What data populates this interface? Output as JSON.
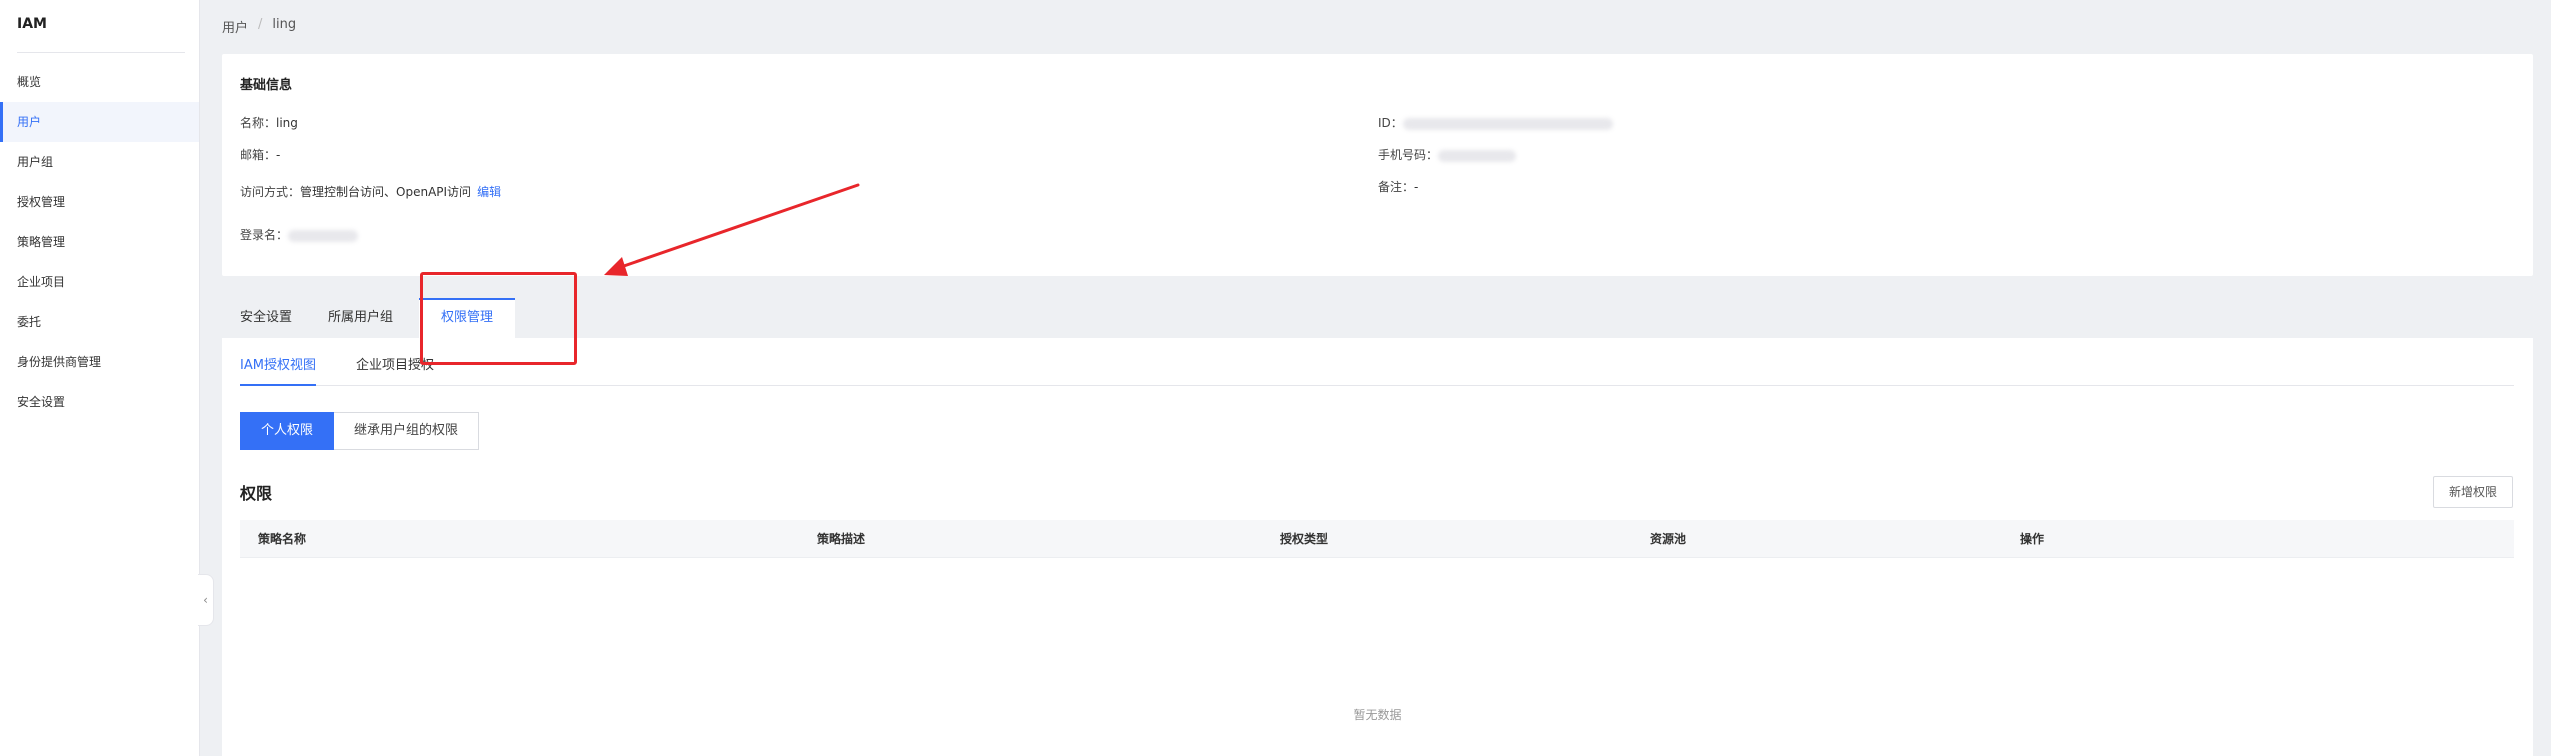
{
  "app": {
    "title": "IAM"
  },
  "sidebar": {
    "items": [
      {
        "label": "概览"
      },
      {
        "label": "用户"
      },
      {
        "label": "用户组"
      },
      {
        "label": "授权管理"
      },
      {
        "label": "策略管理"
      },
      {
        "label": "企业项目"
      },
      {
        "label": "委托"
      },
      {
        "label": "身份提供商管理"
      },
      {
        "label": "安全设置"
      }
    ],
    "active": "用户"
  },
  "breadcrumb": {
    "root": "用户",
    "separator": "/",
    "current": "ling"
  },
  "basic_info": {
    "title": "基础信息",
    "name_label": "名称：",
    "name_value": "ling",
    "email_label": "邮箱：",
    "email_value": "-",
    "access_label": "访问方式：",
    "access_value": "管理控制台访问、OpenAPI访问",
    "edit_link": "编辑",
    "login_label": "登录名：",
    "id_label": "ID：",
    "phone_label": "手机号码：",
    "remark_label": "备注：",
    "remark_value": "-"
  },
  "tabs": [
    {
      "label": "安全设置"
    },
    {
      "label": "所属用户组"
    },
    {
      "label": "权限管理",
      "active": true
    }
  ],
  "subtabs": [
    {
      "label": "IAM授权视图",
      "active": true
    },
    {
      "label": "企业项目授权"
    }
  ],
  "segment": {
    "personal": "个人权限",
    "inherited": "继承用户组的权限"
  },
  "permissions": {
    "title": "权限",
    "add_button": "新增权限",
    "columns": [
      "策略名称",
      "策略描述",
      "授权类型",
      "资源池",
      "操作"
    ],
    "empty_text": "暂无数据"
  },
  "colors": {
    "accent": "#3470f6",
    "annotation": "#e8262b"
  }
}
